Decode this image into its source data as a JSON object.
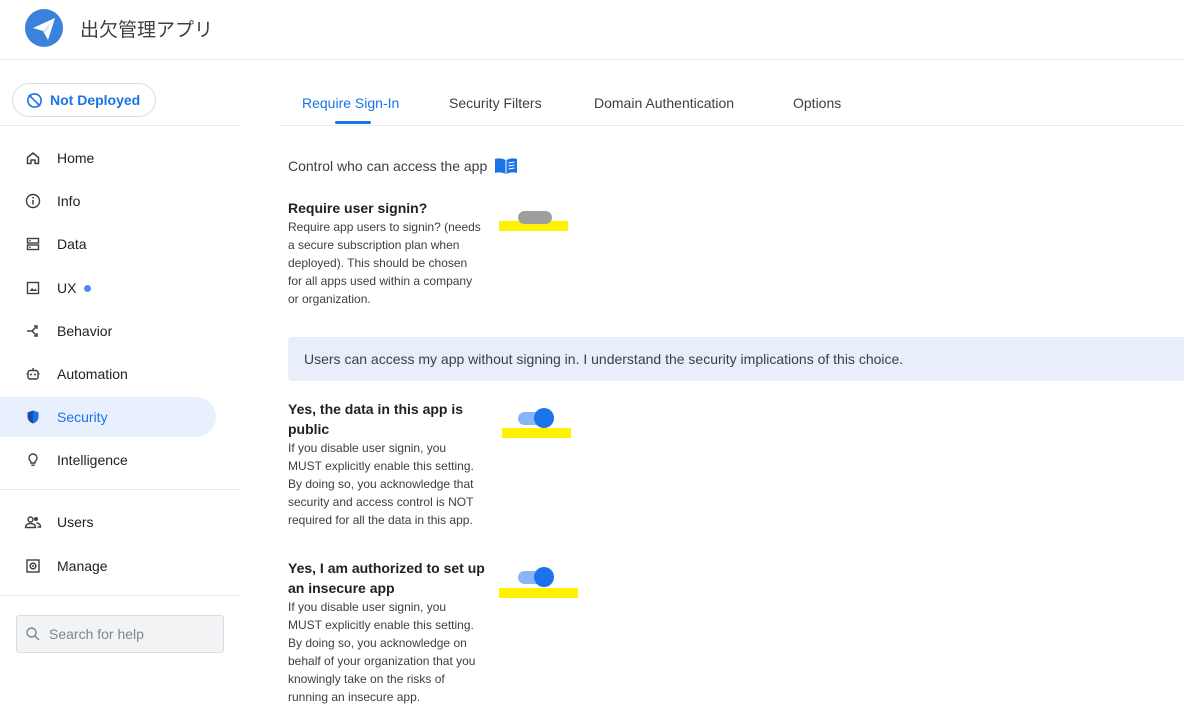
{
  "header": {
    "app_title": "出欠管理アプリ"
  },
  "sidebar": {
    "deploy_status": "Not Deployed",
    "items": [
      {
        "label": "Home",
        "icon": "home-icon"
      },
      {
        "label": "Info",
        "icon": "info-icon"
      },
      {
        "label": "Data",
        "icon": "data-icon"
      },
      {
        "label": "UX",
        "icon": "ux-icon",
        "badge_dot": true
      },
      {
        "label": "Behavior",
        "icon": "behavior-icon"
      },
      {
        "label": "Automation",
        "icon": "automation-icon"
      },
      {
        "label": "Security",
        "icon": "shield-icon",
        "active": true
      },
      {
        "label": "Intelligence",
        "icon": "lightbulb-icon"
      },
      {
        "label": "Users",
        "icon": "users-icon"
      },
      {
        "label": "Manage",
        "icon": "manage-icon"
      }
    ],
    "search_placeholder": "Search for help"
  },
  "tabs": [
    {
      "label": "Require Sign-In",
      "active": true
    },
    {
      "label": "Security Filters"
    },
    {
      "label": "Domain Authentication"
    },
    {
      "label": "Options"
    }
  ],
  "content": {
    "intro": "Control who can access the app",
    "settings": [
      {
        "title": "Require user signin?",
        "desc_lines": [
          "Require app users to signin? (needs",
          "a secure subscription plan when",
          "deployed). This should be chosen",
          "for all apps used within a company",
          "or organization."
        ],
        "enabled": false
      },
      {
        "title_lines": [
          "Yes, the data in this app is",
          "public"
        ],
        "desc_lines": [
          "If you disable user signin, you",
          "MUST explicitly enable this setting.",
          "By doing so, you acknowledge that",
          "security and access control is NOT",
          "required for all the data in this app."
        ],
        "enabled": true
      },
      {
        "title_lines": [
          "Yes, I am authorized to set up",
          "an insecure app"
        ],
        "desc_lines": [
          "If you disable user signin, you",
          "MUST explicitly enable this setting.",
          "By doing so, you acknowledge on",
          "behalf of your organization that you",
          "knowingly take on the risks of",
          "running an insecure app."
        ],
        "enabled": true
      }
    ],
    "banner": "Users can access my app without signing in. I understand the security implications of this choice."
  },
  "colors": {
    "accent": "#1a73e8",
    "active_bg": "#e8f0fe",
    "banner_bg": "#e8effb",
    "highlight": "#fff200"
  }
}
